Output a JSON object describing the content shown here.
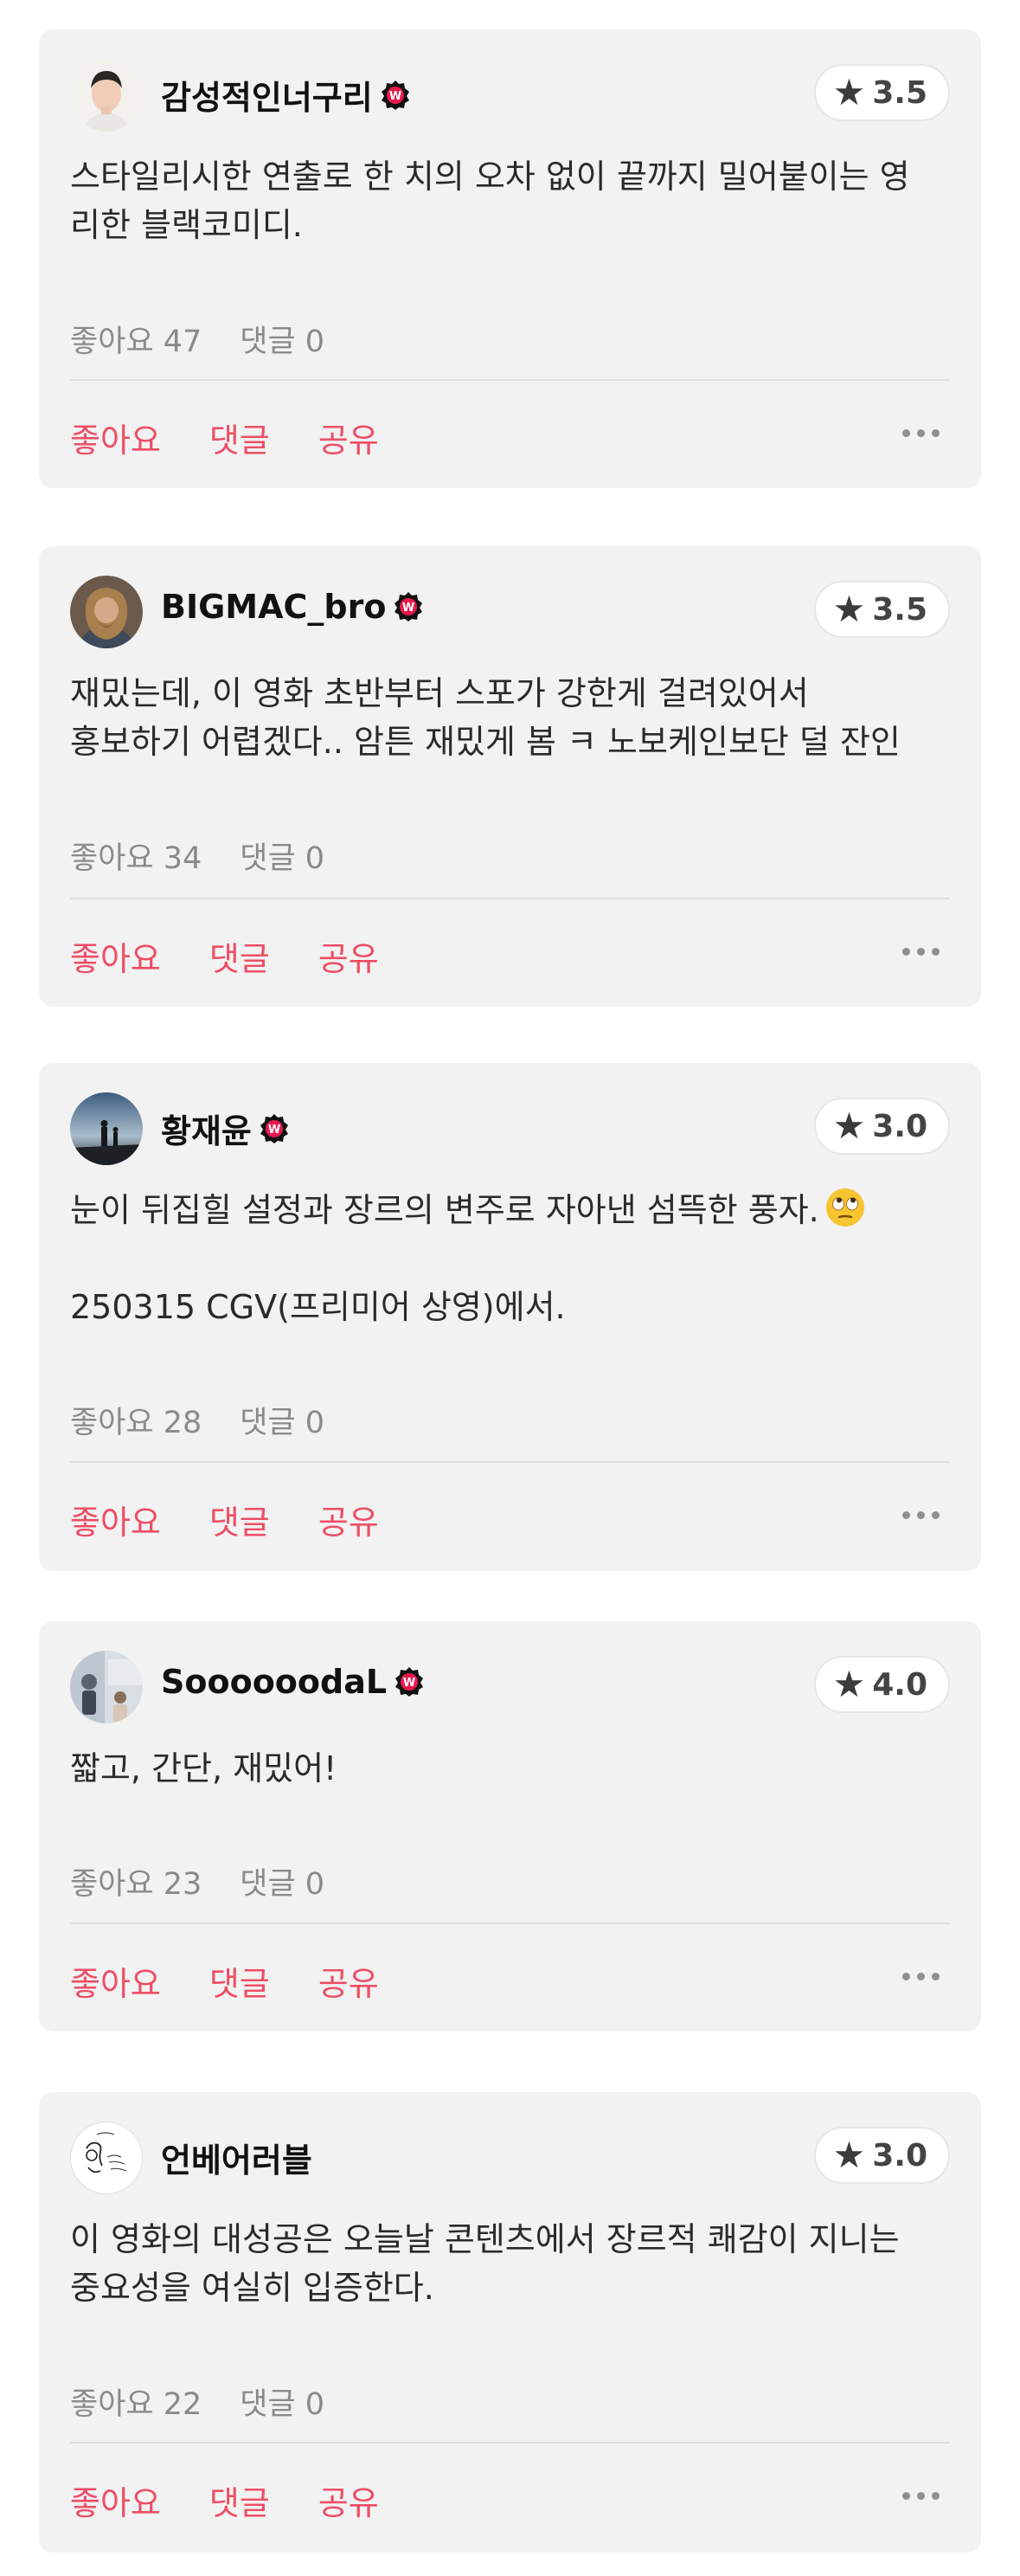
{
  "reviews": [
    {
      "username": "감성적인너구리",
      "rating": "3.5",
      "lines": [
        "스타일리시한 연출로 한 치의 오차 없이 끝까지 밀어붙이는 영",
        "리한 블랙코미디."
      ],
      "likes": "좋아요 47",
      "comments": "댓글 0",
      "has_badge": true,
      "avatar_icon": "boy-portrait-icon"
    },
    {
      "username": "BIGMAC_bro",
      "rating": "3.5",
      "lines": [
        "재밌는데, 이 영화 초반부터 스포가 강한게 걸려있어서",
        "홍보하기 어렵겠다.. 암튼 재밌게 봄 ㅋ 노보케인보단 덜 잔인"
      ],
      "likes": "좋아요 34",
      "comments": "댓글 0",
      "has_badge": true,
      "avatar_icon": "bearded-man-icon"
    },
    {
      "username": "황재윤",
      "rating": "3.0",
      "lines": [
        "눈이 뒤집힐 설정과 장르의 변주로 자아낸 섬뜩한 풍자.",
        "",
        "250315 CGV(프리미어 상영)에서."
      ],
      "likes": "좋아요 28",
      "comments": "댓글 0",
      "has_badge": true,
      "avatar_icon": "silhouette-sky-icon"
    },
    {
      "username": "SoooooodaL",
      "rating": "4.0",
      "lines": [
        "짧고, 간단, 재밌어!"
      ],
      "likes": "좋아요 23",
      "comments": "댓글 0",
      "has_badge": true,
      "avatar_icon": "photo-collage-icon"
    },
    {
      "username": "언베어러블",
      "rating": "3.0",
      "lines": [
        "이 영화의 대성공은 오늘날 콘텐츠에서 장르적 쾌감이 지니는",
        "중요성을 여실히 입증한다."
      ],
      "likes": "좋아요 22",
      "comments": "댓글 0",
      "has_badge": false,
      "avatar_icon": "sketch-drawing-icon"
    }
  ],
  "actions": {
    "like_label": "좋아요",
    "comment_label": "댓글",
    "share_label": "공유"
  },
  "icons": {
    "rating_star": "star-icon",
    "badge": "verified-badge-icon",
    "more": "more-dots-icon",
    "emoji": "eye-roll-emoji-icon"
  },
  "colors": {
    "card_bg": "#f2f2f2",
    "accent": "#ee4e66",
    "badge": "#e8194e",
    "muted": "#8a8a8a"
  }
}
